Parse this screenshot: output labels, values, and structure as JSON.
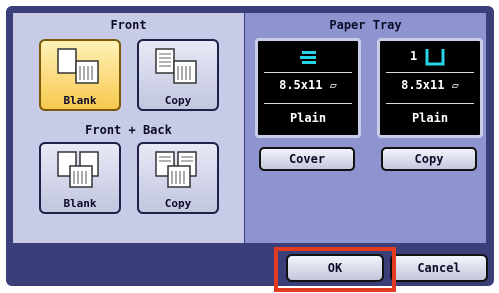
{
  "left": {
    "front_title": "Front",
    "front_back_title": "Front + Back",
    "options": {
      "front_blank": "Blank",
      "front_copy": "Copy",
      "fb_blank": "Blank",
      "fb_copy": "Copy"
    }
  },
  "right": {
    "title": "Paper Tray",
    "tray1": {
      "size": "8.5x11 ▱",
      "type": "Plain",
      "button": "Cover"
    },
    "tray2": {
      "number": "1",
      "size": "8.5x11 ▱",
      "type": "Plain",
      "button": "Copy"
    }
  },
  "footer": {
    "ok": "OK",
    "cancel": "Cancel"
  },
  "colors": {
    "highlight": "#e23b21",
    "selected": "#f7c94d",
    "tray_icon": "#27d3e6"
  }
}
